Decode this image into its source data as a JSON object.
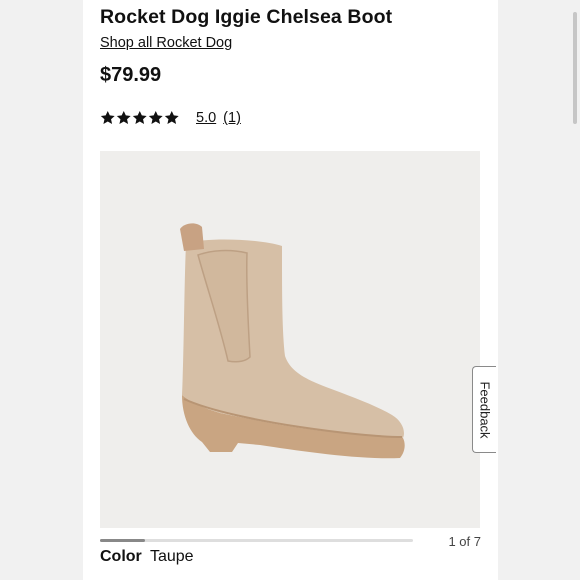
{
  "product": {
    "title": "Rocket Dog Iggie Chelsea Boot",
    "shop_link": "Shop all Rocket Dog",
    "price": "$79.99",
    "rating": {
      "stars": 5,
      "value": "5.0",
      "count": "(1)"
    }
  },
  "gallery": {
    "counter": "1 of 7",
    "current_index": 1,
    "total": 7,
    "image_name": "boot-product-image"
  },
  "color": {
    "label": "Color",
    "value": "Taupe"
  },
  "feedback": {
    "label": "Feedback"
  },
  "colors": {
    "page_background": "#ffffff",
    "outer_background": "#f1f1f1",
    "image_background": "#efeeec",
    "star": "#111111",
    "boot": "#d6bfa6",
    "sole": "#c9a582"
  }
}
